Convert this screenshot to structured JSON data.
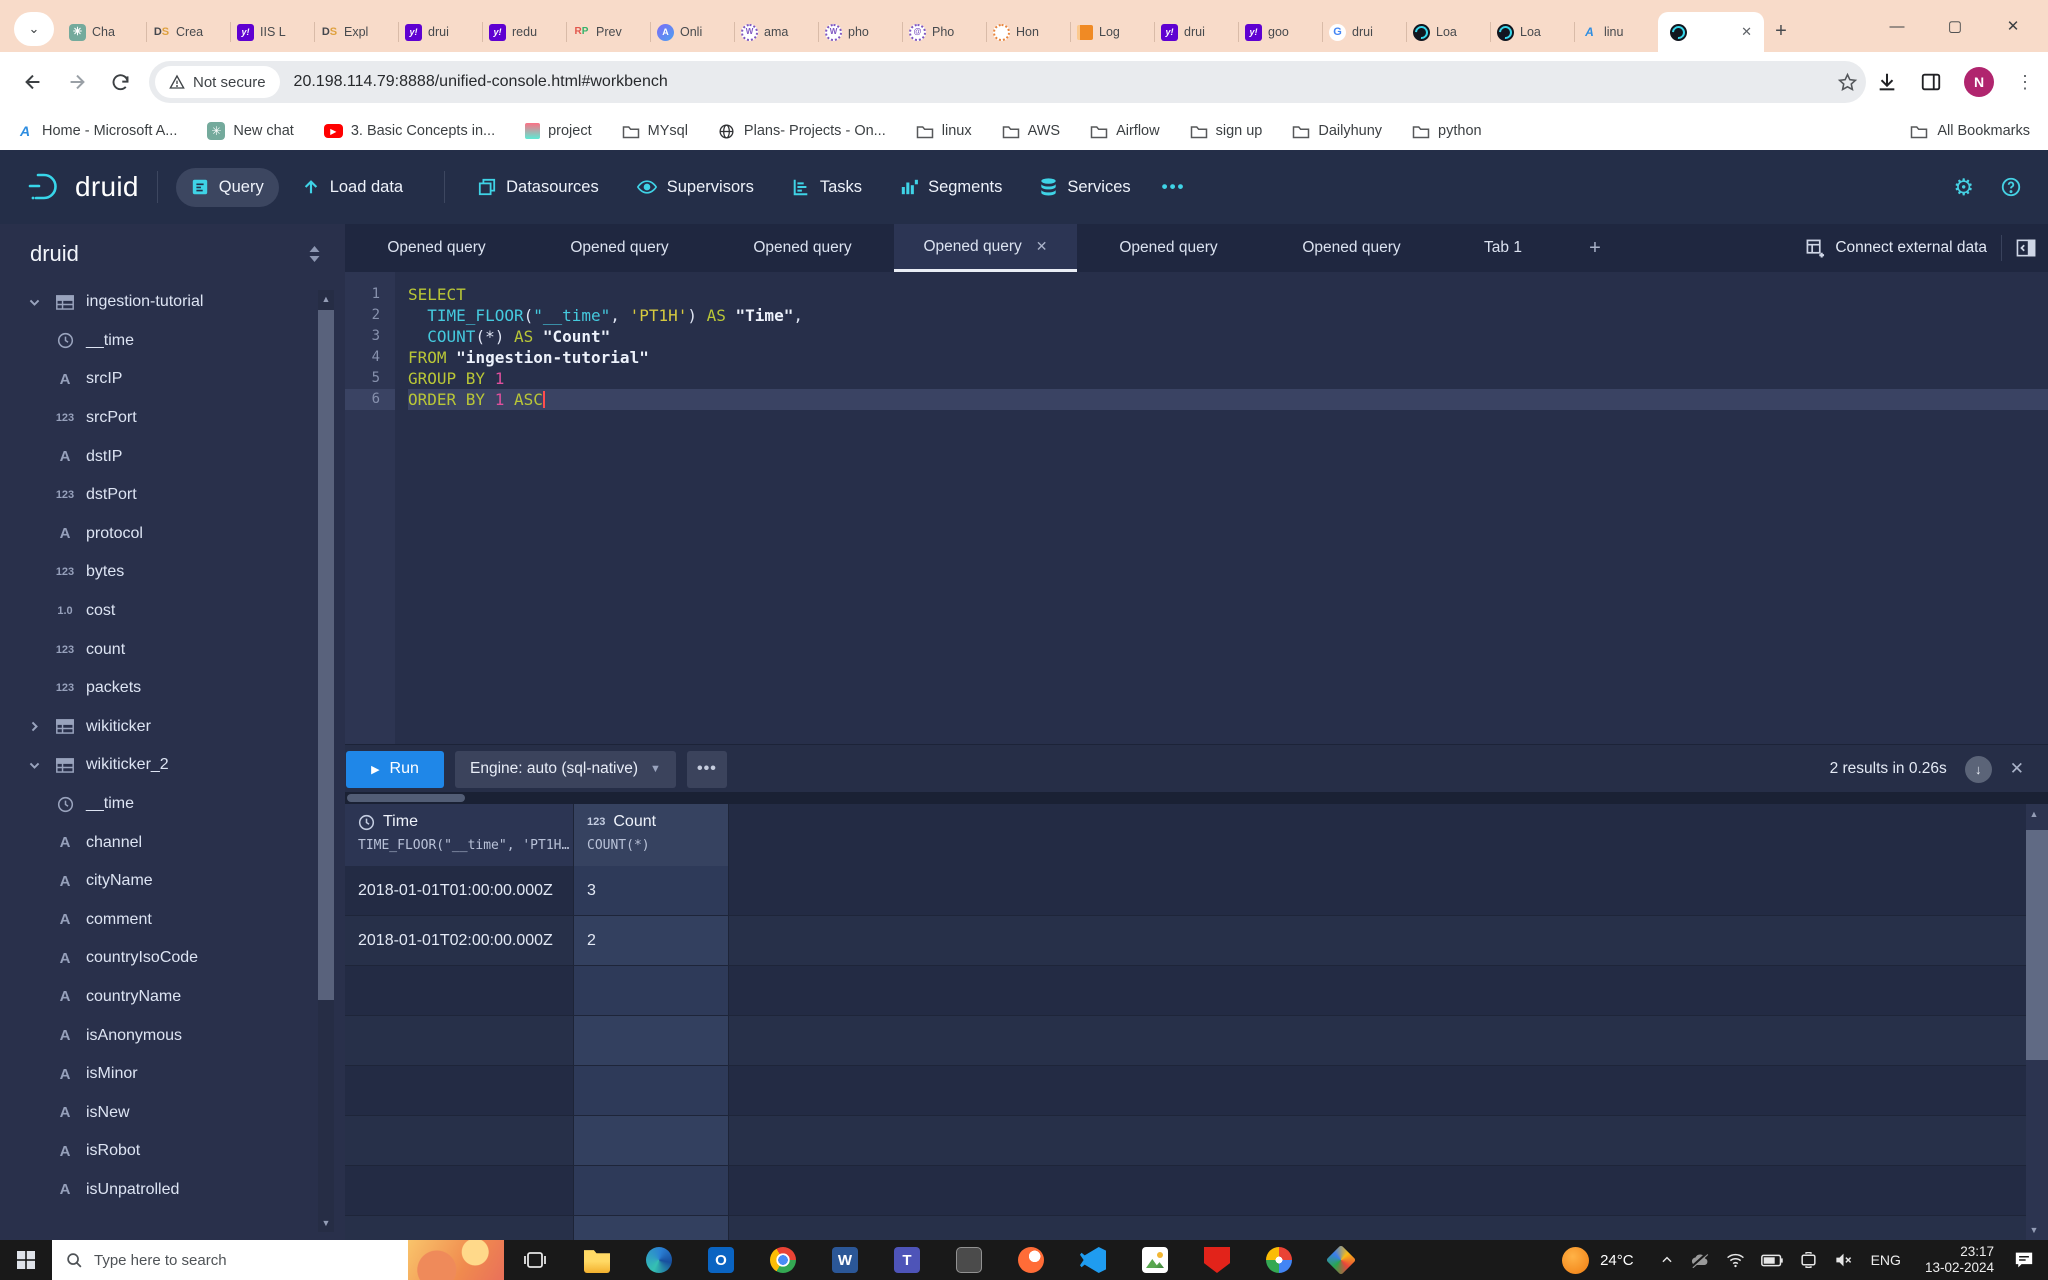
{
  "browser": {
    "tab_search_icon": "chevron-down",
    "tabs": [
      {
        "label": "Cha",
        "fav": "chatgpt"
      },
      {
        "label": "Crea",
        "fav": "ds"
      },
      {
        "label": "IIS L",
        "fav": "yahoo"
      },
      {
        "label": "Expl",
        "fav": "ds"
      },
      {
        "label": "drui",
        "fav": "yahoo"
      },
      {
        "label": "redu",
        "fav": "yahoo"
      },
      {
        "label": "Prev",
        "fav": "rp"
      },
      {
        "label": "Onli",
        "fav": "a-circle"
      },
      {
        "label": "ama",
        "fav": "w-circle"
      },
      {
        "label": "pho",
        "fav": "w-circle"
      },
      {
        "label": "Pho",
        "fav": "at-circle"
      },
      {
        "label": "Hon",
        "fav": "c-circle"
      },
      {
        "label": "Log",
        "fav": "book"
      },
      {
        "label": "drui",
        "fav": "yahoo"
      },
      {
        "label": "goo",
        "fav": "yahoo"
      },
      {
        "label": "drui",
        "fav": "google"
      },
      {
        "label": "Loa",
        "fav": "druid"
      },
      {
        "label": "Loa",
        "fav": "druid"
      },
      {
        "label": "linu",
        "fav": "azure"
      },
      {
        "label": "",
        "fav": "druid",
        "active": true
      }
    ],
    "address": {
      "security_label": "Not secure",
      "url": "20.198.114.79:8888/unified-console.html#workbench"
    },
    "profile_initial": "N",
    "bookmarks": [
      {
        "label": "Home - Microsoft A...",
        "icon": "azure"
      },
      {
        "label": "New chat",
        "icon": "chatgpt"
      },
      {
        "label": "3. Basic Concepts in...",
        "icon": "youtube"
      },
      {
        "label": "project",
        "icon": "project"
      },
      {
        "label": "MYsql",
        "icon": "folder"
      },
      {
        "label": "Plans- Projects - On...",
        "icon": "globe"
      },
      {
        "label": "linux",
        "icon": "folder"
      },
      {
        "label": "AWS",
        "icon": "folder"
      },
      {
        "label": "Airflow",
        "icon": "folder"
      },
      {
        "label": "sign up",
        "icon": "folder"
      },
      {
        "label": "Dailyhuny",
        "icon": "folder"
      },
      {
        "label": "python",
        "icon": "folder"
      }
    ],
    "all_bookmarks_label": "All Bookmarks"
  },
  "navbar": {
    "logo_text": "druid",
    "items": [
      {
        "label": "Query",
        "icon": "query",
        "active": true
      },
      {
        "label": "Load data",
        "icon": "load-data",
        "active": false
      },
      {
        "label": "Datasources",
        "icon": "datasources",
        "active": false,
        "sep_before": true
      },
      {
        "label": "Supervisors",
        "icon": "supervisors",
        "active": false
      },
      {
        "label": "Tasks",
        "icon": "tasks",
        "active": false
      },
      {
        "label": "Segments",
        "icon": "segments",
        "active": false
      },
      {
        "label": "Services",
        "icon": "services",
        "active": false
      }
    ],
    "overflow_label": "•••"
  },
  "workbench": {
    "tabs": [
      "Opened query",
      "Opened query",
      "Opened query",
      "Opened query",
      "Opened query",
      "Opened query",
      "Tab 1"
    ],
    "active_index": 3,
    "connect_label": "Connect external data"
  },
  "sidebar": {
    "title": "druid",
    "tree": [
      {
        "label": "ingestion-tutorial",
        "icon": "table",
        "chevron": "down"
      },
      {
        "label": "__time",
        "icon": "clock",
        "child": true
      },
      {
        "label": "srcIP",
        "icon": "A",
        "child": true
      },
      {
        "label": "srcPort",
        "icon": "123",
        "child": true
      },
      {
        "label": "dstIP",
        "icon": "A",
        "child": true
      },
      {
        "label": "dstPort",
        "icon": "123",
        "child": true
      },
      {
        "label": "protocol",
        "icon": "A",
        "child": true
      },
      {
        "label": "bytes",
        "icon": "123",
        "child": true
      },
      {
        "label": "cost",
        "icon": "1.0",
        "child": true
      },
      {
        "label": "count",
        "icon": "123",
        "child": true
      },
      {
        "label": "packets",
        "icon": "123",
        "child": true
      },
      {
        "label": "wikiticker",
        "icon": "table",
        "chevron": "right"
      },
      {
        "label": "wikiticker_2",
        "icon": "table",
        "chevron": "down"
      },
      {
        "label": "__time",
        "icon": "clock",
        "child": true
      },
      {
        "label": "channel",
        "icon": "A",
        "child": true
      },
      {
        "label": "cityName",
        "icon": "A",
        "child": true
      },
      {
        "label": "comment",
        "icon": "A",
        "child": true
      },
      {
        "label": "countryIsoCode",
        "icon": "A",
        "child": true
      },
      {
        "label": "countryName",
        "icon": "A",
        "child": true
      },
      {
        "label": "isAnonymous",
        "icon": "A",
        "child": true
      },
      {
        "label": "isMinor",
        "icon": "A",
        "child": true
      },
      {
        "label": "isNew",
        "icon": "A",
        "child": true
      },
      {
        "label": "isRobot",
        "icon": "A",
        "child": true
      },
      {
        "label": "isUnpatrolled",
        "icon": "A",
        "child": true
      }
    ]
  },
  "editor": {
    "active_line": 6,
    "lines": [
      [
        {
          "t": "SELECT",
          "c": "kw"
        }
      ],
      [
        {
          "t": "  ",
          "c": "pl"
        },
        {
          "t": "TIME_FLOOR",
          "c": "fn"
        },
        {
          "t": "(",
          "c": "pl"
        },
        {
          "t": "\"__time\"",
          "c": "ref"
        },
        {
          "t": ", ",
          "c": "pl"
        },
        {
          "t": "'PT1H'",
          "c": "str"
        },
        {
          "t": ") ",
          "c": "pl"
        },
        {
          "t": "AS",
          "c": "kw"
        },
        {
          "t": " ",
          "c": "pl"
        },
        {
          "t": "\"Time\"",
          "c": "alias"
        },
        {
          "t": ",",
          "c": "pl"
        }
      ],
      [
        {
          "t": "  ",
          "c": "pl"
        },
        {
          "t": "COUNT",
          "c": "fn"
        },
        {
          "t": "(*) ",
          "c": "pl"
        },
        {
          "t": "AS",
          "c": "kw"
        },
        {
          "t": " ",
          "c": "pl"
        },
        {
          "t": "\"Count\"",
          "c": "alias"
        }
      ],
      [
        {
          "t": "FROM",
          "c": "kw"
        },
        {
          "t": " ",
          "c": "pl"
        },
        {
          "t": "\"ingestion-tutorial\"",
          "c": "alias"
        }
      ],
      [
        {
          "t": "GROUP BY",
          "c": "kw"
        },
        {
          "t": " ",
          "c": "pl"
        },
        {
          "t": "1",
          "c": "num"
        }
      ],
      [
        {
          "t": "ORDER BY",
          "c": "kw"
        },
        {
          "t": " ",
          "c": "pl"
        },
        {
          "t": "1",
          "c": "num"
        },
        {
          "t": " ",
          "c": "pl"
        },
        {
          "t": "ASC",
          "c": "kw"
        }
      ]
    ]
  },
  "runbar": {
    "run_label": "Run",
    "engine_label": "Engine: auto (sql-native)",
    "more_label": "•••",
    "status": "2 results in 0.26s"
  },
  "results": {
    "columns": [
      {
        "name": "Time",
        "type_icon": "clock",
        "expr": "TIME_FLOOR(\"__time\", 'PT1H…"
      },
      {
        "name": "Count",
        "type_icon": "123",
        "expr": "COUNT(*)"
      }
    ],
    "rows": [
      [
        "2018-01-01T01:00:00.000Z",
        "3"
      ],
      [
        "2018-01-01T02:00:00.000Z",
        "2"
      ]
    ],
    "empty_rows": 6
  },
  "taskbar": {
    "search_placeholder": "Type here to search",
    "pinned": [
      "taskview",
      "explorer",
      "edge",
      "outlook",
      "chrome",
      "word",
      "teams",
      "glass",
      "postman",
      "vscode",
      "photos",
      "shield",
      "pinwheel",
      "diamond"
    ],
    "tray": {
      "temp": "24°C",
      "lang": "ENG",
      "time": "23:17",
      "date": "13-02-2024"
    }
  }
}
